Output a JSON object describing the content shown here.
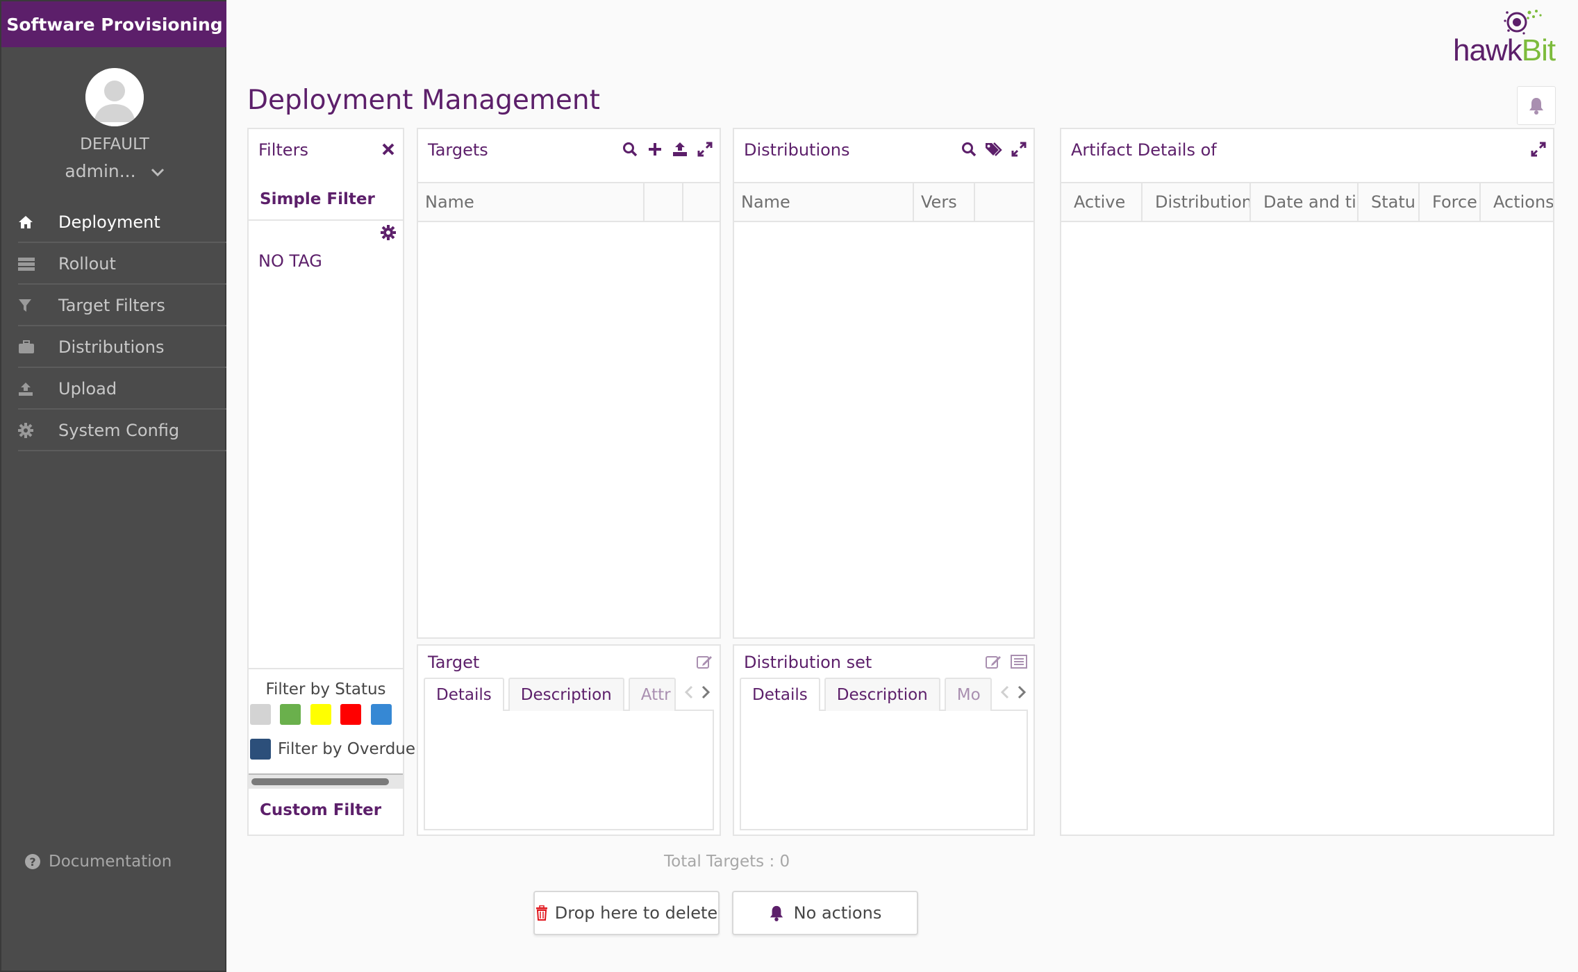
{
  "sidebar": {
    "app_title": "Software Provisioning",
    "tenant": "DEFAULT",
    "user": "admin...",
    "items": [
      {
        "label": "Deployment",
        "icon": "home-icon"
      },
      {
        "label": "Rollout",
        "icon": "rollout-icon"
      },
      {
        "label": "Target Filters",
        "icon": "filter-icon"
      },
      {
        "label": "Distributions",
        "icon": "briefcase-icon"
      },
      {
        "label": "Upload",
        "icon": "upload-icon"
      },
      {
        "label": "System Config",
        "icon": "gear-icon"
      }
    ],
    "active_index": 0,
    "documentation": "Documentation"
  },
  "header": {
    "page_title": "Deployment Management",
    "logo_text_hawk": "hawk",
    "logo_text_bit": "Bit"
  },
  "filters": {
    "title": "Filters",
    "simple_filter": "Simple Filter",
    "no_tag": "NO TAG",
    "filter_by_status": "Filter by Status",
    "status_colors": [
      "#d3d3d3",
      "#6ab04c",
      "#ffff00",
      "#ff0000",
      "#3688d4"
    ],
    "filter_by_overdue": "Filter by Overdue",
    "custom_filter": "Custom Filter"
  },
  "targets": {
    "title": "Targets",
    "columns": [
      "Name",
      "",
      ""
    ]
  },
  "distributions": {
    "title": "Distributions",
    "columns": [
      "Name",
      "Vers",
      ""
    ]
  },
  "artifact_details": {
    "title": "Artifact Details of",
    "columns": [
      "Active",
      "Distribution:",
      "Date and tir",
      "Statu",
      "Force",
      "Actions"
    ]
  },
  "target_details": {
    "title": "Target",
    "tabs": [
      "Details",
      "Description",
      "Attr"
    ]
  },
  "dist_set_details": {
    "title": "Distribution set",
    "tabs": [
      "Details",
      "Description",
      "Mo"
    ]
  },
  "footer": {
    "total_targets": "Total Targets : 0",
    "delete_label": "Drop here to delete",
    "actions_label": "No actions"
  },
  "colors": {
    "brand": "#5c1f6a",
    "sidebar": "#4b4b4b",
    "logo_green": "#7dbb3c"
  }
}
